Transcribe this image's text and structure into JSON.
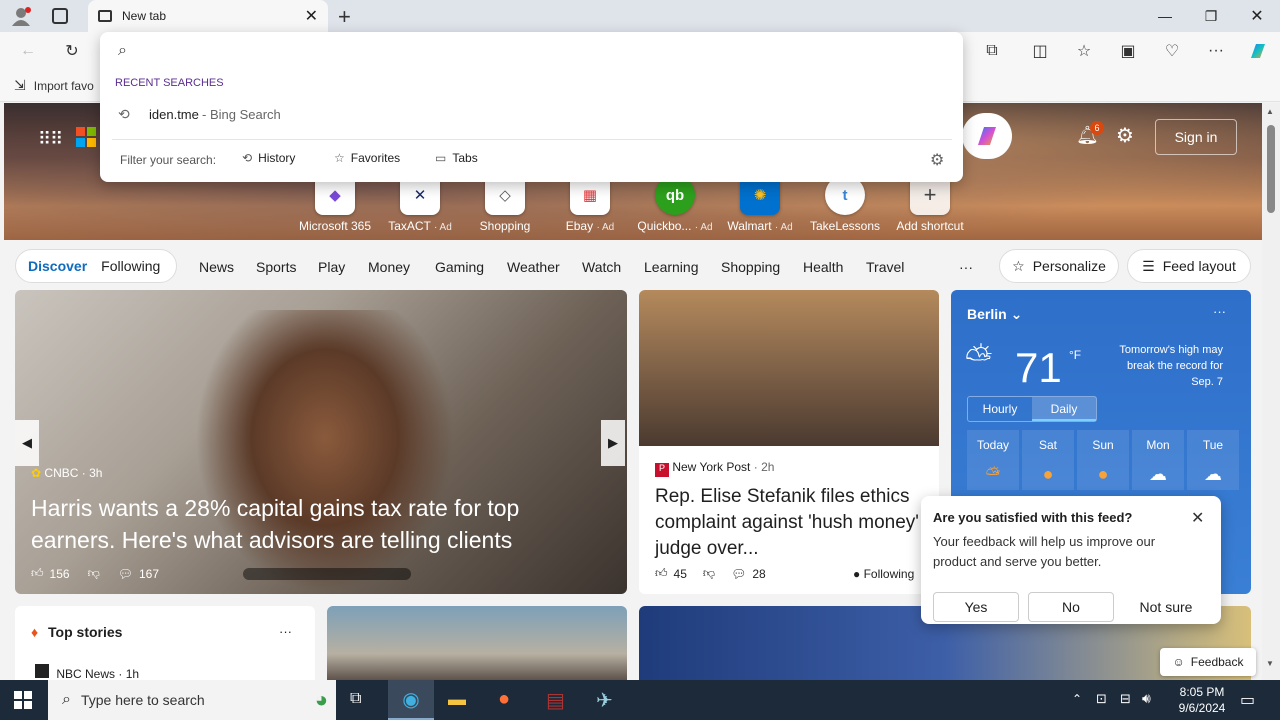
{
  "browser": {
    "tab_title": "New tab",
    "favorites_bar_item": "Import favo"
  },
  "omnibox": {
    "recent_label": "RECENT SEARCHES",
    "recent_item": "iden.tme",
    "recent_item_source": " - Bing Search",
    "filter_label": "Filter your search:",
    "filters": [
      "History",
      "Favorites",
      "Tabs"
    ]
  },
  "header": {
    "notification_count": "6",
    "signin_label": "Sign in"
  },
  "shortcuts": [
    {
      "label": "Microsoft 365",
      "ad": ""
    },
    {
      "label": "TaxACT",
      "ad": "· Ad"
    },
    {
      "label": "Shopping",
      "ad": ""
    },
    {
      "label": "Ebay",
      "ad": "· Ad"
    },
    {
      "label": "Quickbo...",
      "ad": "· Ad"
    },
    {
      "label": "Walmart",
      "ad": "· Ad"
    },
    {
      "label": "TakeLessons",
      "ad": ""
    },
    {
      "label": "Add shortcut",
      "ad": ""
    }
  ],
  "nav": {
    "discover": "Discover",
    "following": "Following",
    "links": [
      "News",
      "Sports",
      "Play",
      "Money",
      "Gaming",
      "Weather",
      "Watch",
      "Learning",
      "Shopping",
      "Health",
      "Travel"
    ],
    "more": "···",
    "personalize": "Personalize",
    "feed_layout": "Feed layout"
  },
  "main_story": {
    "source": "CNBC",
    "age": "· 3h",
    "headline": "Harris wants a 28% capital gains tax rate for top earners. Here's what advisors are telling clients",
    "likes": "156",
    "comments": "167"
  },
  "second_story": {
    "source": "New York Post",
    "age": "· 2h",
    "headline": "Rep. Elise Stefanik files ethics complaint against 'hush money' judge over...",
    "likes": "45",
    "comments": "28",
    "following": "Following"
  },
  "weather": {
    "city": "Berlin",
    "temp": "71",
    "unit": "°F",
    "note": "Tomorrow's high may break the record for Sep. 7",
    "tabs": [
      "Hourly",
      "Daily"
    ],
    "days": [
      "Today",
      "Sat",
      "Sun",
      "Mon",
      "Tue"
    ]
  },
  "top_stories": {
    "title": "Top stories",
    "first_source": "NBC News",
    "first_age": "· 1h"
  },
  "feedback_popup": {
    "question": "Are you satisfied with this feed?",
    "body": "Your feedback will help us improve our product and serve you better.",
    "yes": "Yes",
    "no": "No",
    "not_sure": "Not sure"
  },
  "feedback_button": "Feedback",
  "taskbar": {
    "search_placeholder": "Type here to search",
    "time": "8:05 PM",
    "date": "9/6/2024"
  }
}
